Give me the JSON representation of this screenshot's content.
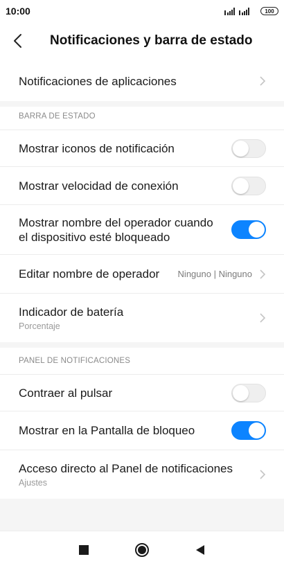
{
  "status_bar": {
    "time": "10:00",
    "battery": "100"
  },
  "header": {
    "title": "Notificaciones y barra de estado"
  },
  "rows": {
    "app_notifications": {
      "label": "Notificaciones de aplicaciones"
    },
    "show_notification_icons": {
      "label": "Mostrar iconos de notificación",
      "enabled": false
    },
    "show_connection_speed": {
      "label": "Mostrar velocidad de conexión",
      "enabled": false
    },
    "show_carrier_name": {
      "label_line1": "Mostrar nombre del operador cuando",
      "label_line2": "el dispositivo esté bloqueado",
      "enabled": true
    },
    "edit_carrier_name": {
      "label": "Editar nombre de operador",
      "value": "Ninguno | Ninguno"
    },
    "battery_indicator": {
      "label": "Indicador de batería",
      "sub": "Porcentaje"
    },
    "collapse_on_tap": {
      "label": "Contraer al pulsar",
      "enabled": false
    },
    "show_on_lockscreen": {
      "label": "Mostrar en la Pantalla de bloqueo",
      "enabled": true
    },
    "notification_shade_shortcut": {
      "label": "Acceso directo al Panel de notificaciones",
      "sub": "Ajustes"
    }
  },
  "sections": {
    "status_bar": "BARRA DE ESTADO",
    "notification_shade": "PANEL DE NOTIFICACIONES"
  },
  "colors": {
    "accent": "#0d84ff",
    "section_bg": "#f5f5f5"
  }
}
